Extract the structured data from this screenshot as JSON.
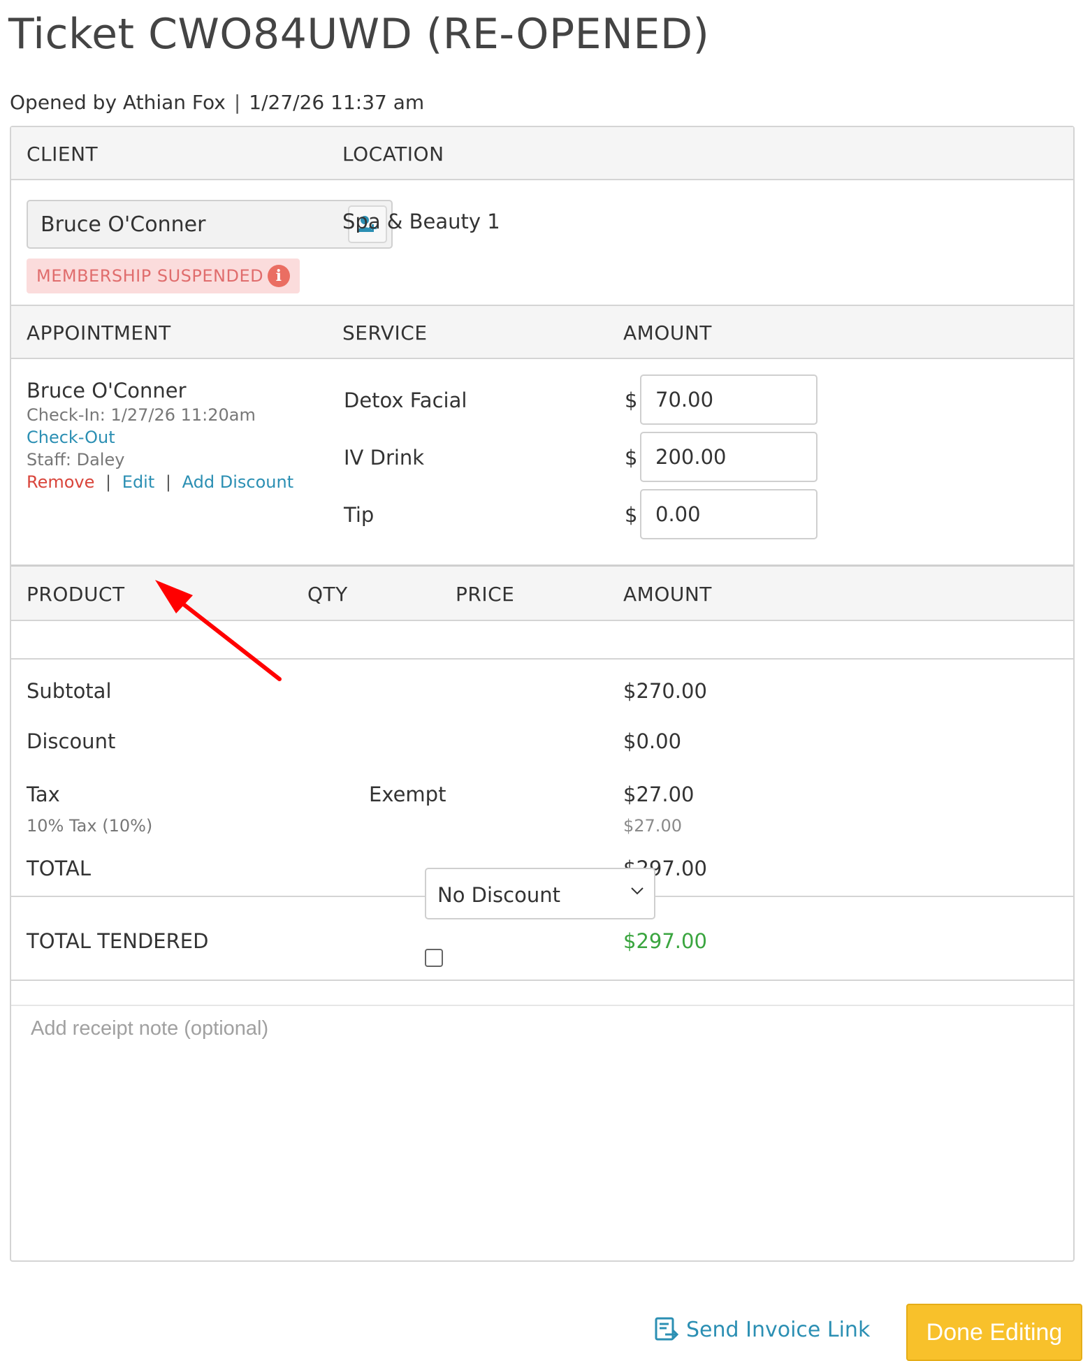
{
  "page": {
    "title": "Ticket CWO84UWD (RE-OPENED)",
    "opened_by": "Opened by Athian Fox",
    "opened_at": "1/27/26 11:37 am"
  },
  "client_section": {
    "client_header": "CLIENT",
    "location_header": "LOCATION",
    "client_name": "Bruce O'Conner",
    "add_client_icon": "add-user-icon",
    "membership_badge": "MEMBERSHIP SUSPENDED",
    "location_value": "Spa & Beauty 1"
  },
  "appointment_section": {
    "headers": {
      "appointment": "APPOINTMENT",
      "service": "SERVICE",
      "amount": "AMOUNT"
    },
    "client_name": "Bruce O'Conner",
    "check_in": "Check-In: 1/27/26 11:20am",
    "check_out_link": "Check-Out",
    "staff": "Staff: Daley",
    "actions": {
      "remove": "Remove",
      "edit": "Edit",
      "add_discount": "Add Discount",
      "separator": "|"
    },
    "currency_symbol": "$",
    "lines": [
      {
        "service": "Detox Facial",
        "amount": "70.00"
      },
      {
        "service": "IV Drink",
        "amount": "200.00"
      },
      {
        "service": "Tip",
        "amount": "0.00"
      }
    ]
  },
  "product_section": {
    "headers": {
      "product": "PRODUCT",
      "qty": "QTY",
      "price": "PRICE",
      "amount": "AMOUNT"
    }
  },
  "totals": {
    "subtotal_label": "Subtotal",
    "subtotal_value": "$270.00",
    "discount_label": "Discount",
    "discount_select": "No Discount",
    "discount_value": "$0.00",
    "tax_label": "Tax",
    "exempt_label": "Exempt",
    "exempt_checked": false,
    "tax_value": "$27.00",
    "tax_detail_label": "10% Tax (10%)",
    "tax_detail_value": "$27.00",
    "total_label": "TOTAL",
    "total_value": "$297.00",
    "tendered_label": "TOTAL TENDERED",
    "tendered_value": "$297.00"
  },
  "receipt_note": {
    "placeholder": "Add receipt note (optional)"
  },
  "footer": {
    "send_invoice_link": "Send Invoice Link",
    "done_button": "Done Editing"
  },
  "colors": {
    "link": "#2b8fb3",
    "danger": "#d9453b",
    "success": "#3aa53f",
    "badge_bg": "#fbdcdc",
    "badge_text": "#e06d6d",
    "primary_button": "#f8c12b",
    "annotation_arrow": "#ff0000"
  }
}
